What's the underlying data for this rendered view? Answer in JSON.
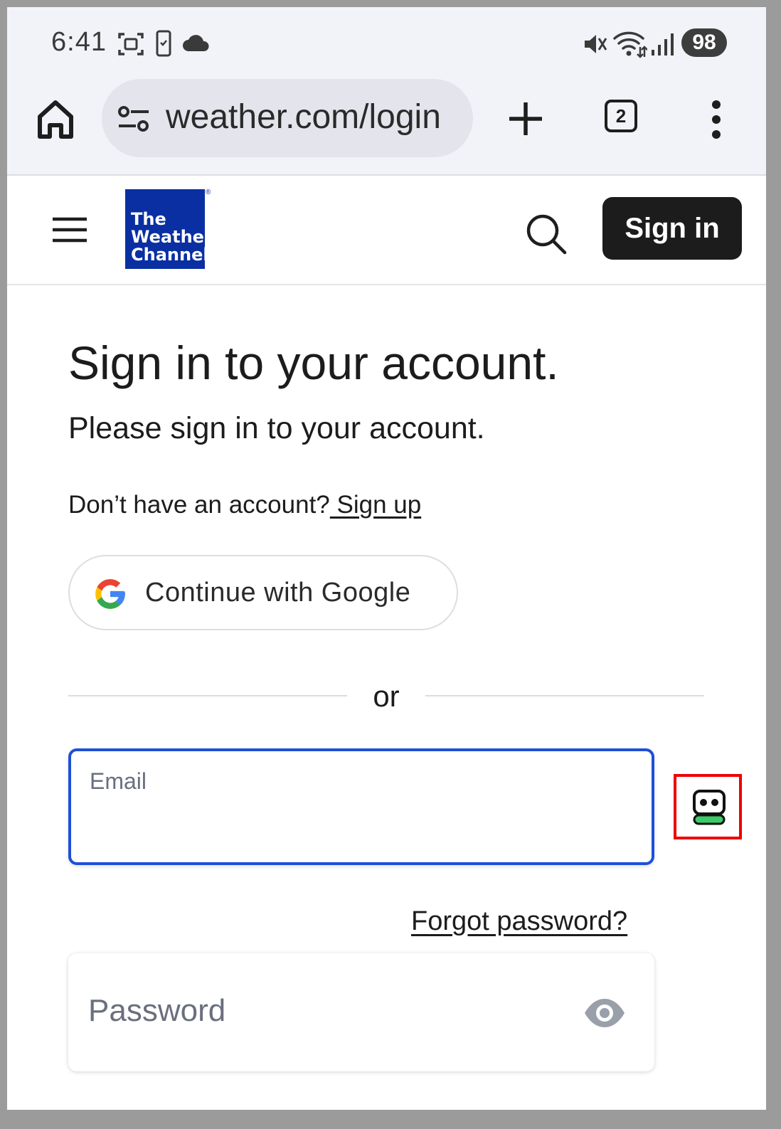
{
  "status_bar": {
    "time": "6:41",
    "battery": "98",
    "icons": [
      "screenshot-icon",
      "phone-check-icon",
      "cloud-icon",
      "mute-icon",
      "wifi-icon",
      "signal-icon"
    ]
  },
  "browser": {
    "url": "weather.com/login",
    "tab_count": "2"
  },
  "header": {
    "logo_lines": [
      "The",
      "Weather",
      "Channel"
    ],
    "logo_reg": "®",
    "sign_in_label": "Sign in",
    "brand_color": "#0a2fa2"
  },
  "main": {
    "title": "Sign in to your account.",
    "subtitle": "Please sign in to your account.",
    "no_account_text": "Don’t have an account?",
    "sign_up_link": " Sign up",
    "google_button": "Continue with Google",
    "or_text": "or",
    "email_label": "Email",
    "email_value": "",
    "forgot_password": "Forgot password?",
    "password_label": "Password",
    "focus_color": "#1f4fd8",
    "highlight_color": "#ee0000"
  }
}
